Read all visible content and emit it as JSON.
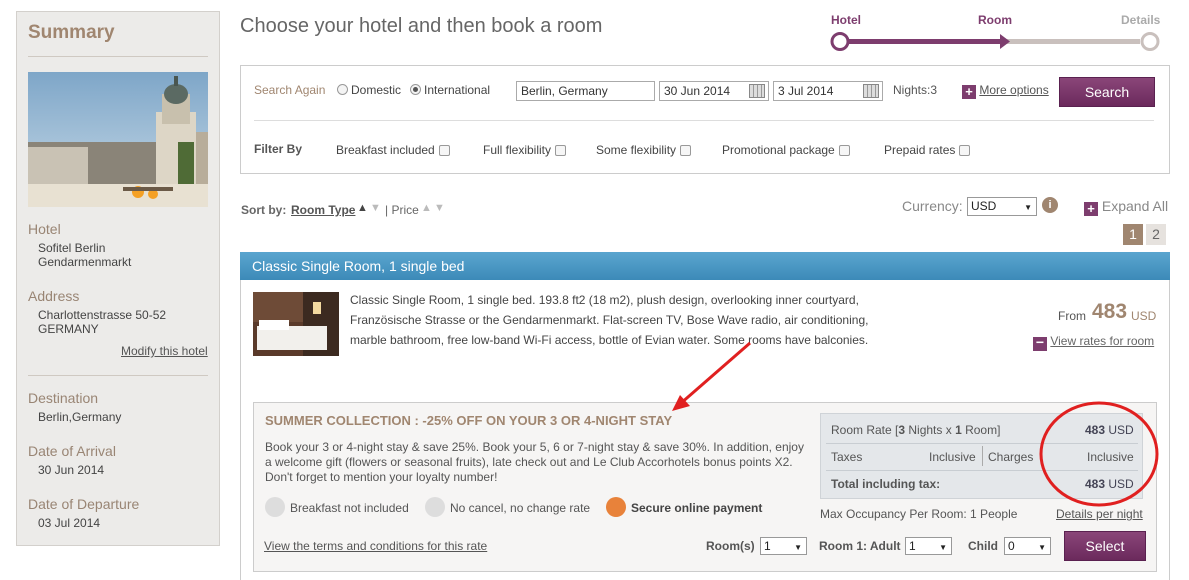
{
  "sidebar": {
    "title": "Summary",
    "hotel_label": "Hotel",
    "hotel_name_line1": "Sofitel Berlin",
    "hotel_name_line2": "Gendarmenmarkt",
    "address_label": "Address",
    "address_line1": "Charlottenstrasse 50-52",
    "address_line2": "GERMANY",
    "modify_link": "Modify this hotel",
    "destination_label": "Destination",
    "destination": "Berlin,Germany",
    "arrival_label": "Date of Arrival",
    "arrival": "30 Jun 2014",
    "departure_label": "Date of Departure",
    "departure": "03 Jul 2014"
  },
  "header": {
    "title": "Choose your hotel and then book a room",
    "steps": [
      "Hotel",
      "Room",
      "Details"
    ]
  },
  "search": {
    "search_again": "Search Again",
    "domestic": "Domestic",
    "international": "International",
    "destination_value": "Berlin, Germany",
    "checkin_value": "30 Jun 2014",
    "checkout_value": "3 Jul 2014",
    "nights": "Nights:3",
    "more_options": "More options",
    "search_button": "Search",
    "filter_by": "Filter By",
    "filters": [
      "Breakfast included",
      "Full flexibility",
      "Some flexibility",
      "Promotional package",
      "Prepaid rates"
    ]
  },
  "sort": {
    "label": "Sort by:",
    "room_type": "Room Type",
    "price": "| Price",
    "currency_label": "Currency:",
    "currency_value": "USD",
    "expand_all": "Expand All",
    "pages": [
      "1",
      "2"
    ]
  },
  "room": {
    "title": "Classic Single Room, 1 single bed",
    "description": "Classic Single Room, 1 single bed. 193.8 ft2 (18 m2), plush design, overlooking inner courtyard, Französische Strasse or the Gendarmenmarkt. Flat-screen TV, Bose Wave radio, air conditioning, marble bathroom, free low-band Wi-Fi access, bottle of Evian water. Some rooms have balconies.",
    "from_label": "From",
    "from_price": "483",
    "from_currency": "USD",
    "view_rates": "View rates for room"
  },
  "offer": {
    "title": "SUMMER COLLECTION : -25% OFF ON YOUR 3 OR 4-NIGHT STAY",
    "text": "Book your 3 or 4-night stay & save 25%. Book your 5, 6 or 7-night stay & save 30%. In addition, enjoy a welcome gift (flowers or seasonal fruits), late check out and Le Club Accorhotels bonus points X2. Don't forget to mention your loyalty number!",
    "breakfast": "Breakfast not included",
    "cancel": "No cancel, no change rate",
    "secure": "Secure online payment",
    "terms_link": "View the terms and conditions for this rate",
    "rate_label_pre": "Room Rate [",
    "rate_nights": "3",
    "rate_label_mid": " Nights x ",
    "rate_rooms": "1",
    "rate_label_post": " Room]",
    "rate_value": "483",
    "rate_currency": "USD",
    "taxes_label": "Taxes",
    "taxes_value": "Inclusive",
    "charges_label": "Charges",
    "charges_value": "Inclusive",
    "total_label": "Total including tax:",
    "total_value": "483",
    "total_currency": "USD",
    "max_occupancy": "Max Occupancy Per Room: 1 People",
    "details_link": "Details per night",
    "rooms_label": "Room(s)",
    "rooms_value": "1",
    "adult_label": "Room 1: Adult",
    "adult_value": "1",
    "child_label": "Child",
    "child_value": "0",
    "select_button": "Select"
  },
  "colors": {
    "accent": "#7d3d6e",
    "room_bar": "#4797c3",
    "annotation": "#e02020"
  }
}
